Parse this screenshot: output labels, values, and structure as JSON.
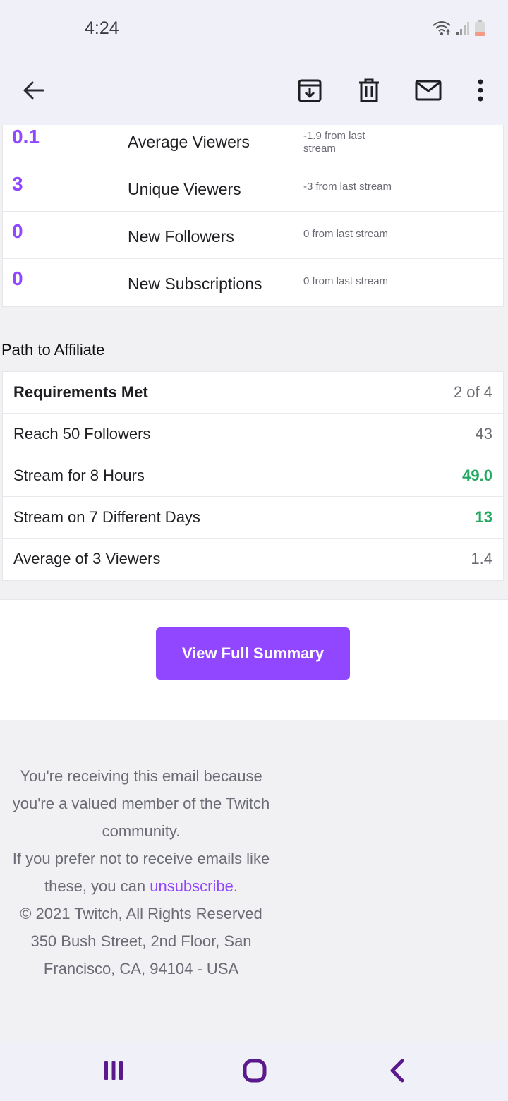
{
  "status_bar": {
    "time": "4:24",
    "icons": [
      "wifi-icon",
      "signal-icon",
      "battery-icon"
    ]
  },
  "app_bar": {
    "icons": [
      "back-arrow-icon",
      "archive-icon",
      "trash-icon",
      "mail-icon",
      "more-vert-icon"
    ]
  },
  "stats": [
    {
      "value": "0.1",
      "label": "Average Viewers",
      "delta": "-1.9 from last stream"
    },
    {
      "value": "3",
      "label": "Unique Viewers",
      "delta": "-3 from last stream"
    },
    {
      "value": "0",
      "label": "New Followers",
      "delta": "0 from last stream"
    },
    {
      "value": "0",
      "label": "New Subscriptions",
      "delta": "0 from last stream"
    }
  ],
  "affiliate": {
    "title": "Path to Affiliate",
    "header": {
      "label": "Requirements Met",
      "value": "2 of 4"
    },
    "rows": [
      {
        "label": "Reach 50 Followers",
        "value": "43",
        "met": false
      },
      {
        "label": "Stream for 8 Hours",
        "value": "49.0",
        "met": true
      },
      {
        "label": "Stream on 7 Different Days",
        "value": "13",
        "met": true
      },
      {
        "label": "Average of 3 Viewers",
        "value": "1.4",
        "met": false
      }
    ]
  },
  "cta": {
    "label": "View Full Summary"
  },
  "footer": {
    "line1": "You're receiving this email because you're a valued member of the Twitch community.",
    "line2_pre": "If you prefer not to receive emails like these, you can ",
    "unsubscribe": "unsubscribe",
    "line2_post": ".",
    "copyright": "© 2021 Twitch, All Rights Reserved",
    "address": "350 Bush Street, 2nd Floor, San Francisco, CA, 94104 - USA"
  },
  "colors": {
    "accent": "#9147ff",
    "met": "#22a860",
    "muted": "#6b6b75"
  }
}
